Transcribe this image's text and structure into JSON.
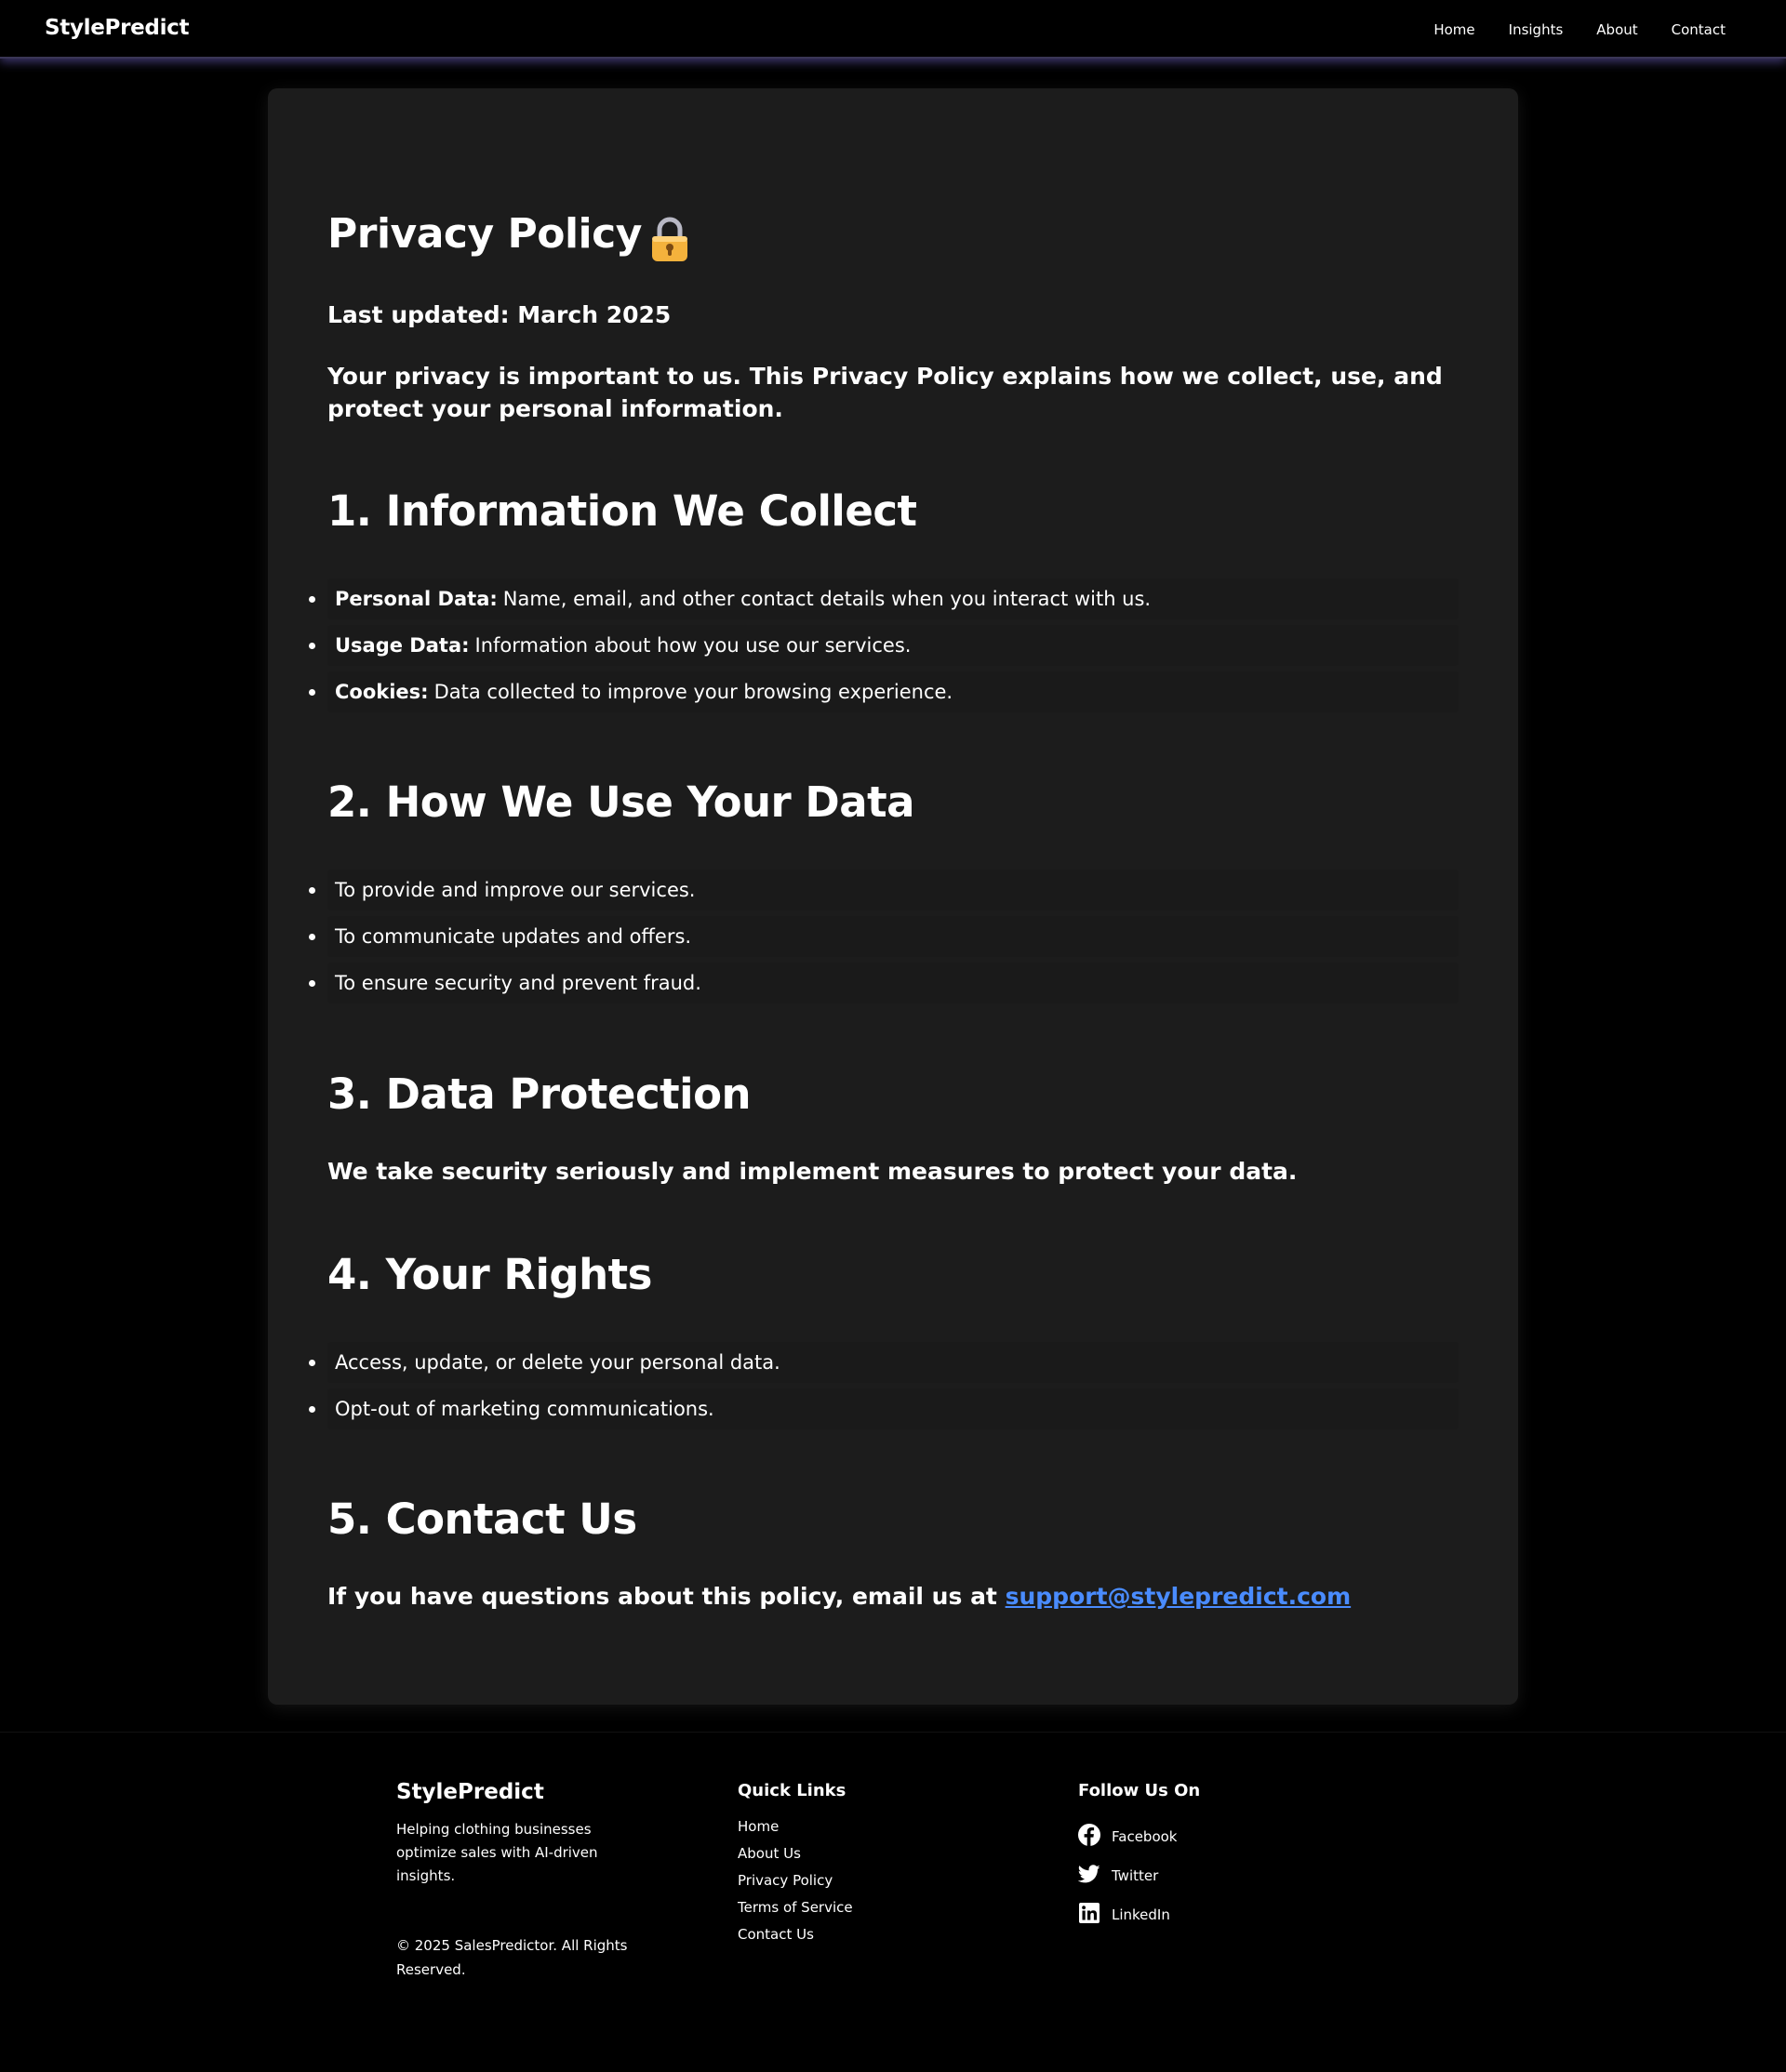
{
  "nav": {
    "brand": "StylePredict",
    "links": [
      "Home",
      "Insights",
      "About",
      "Contact"
    ]
  },
  "policy": {
    "title": "Privacy Policy",
    "title_icon": "lock-icon",
    "updated": "Last updated: March 2025",
    "intro": "Your privacy is important to us. This Privacy Policy explains how we collect, use, and protect your personal information.",
    "sections": [
      {
        "heading": "1. Information We Collect",
        "items": [
          {
            "strong": "Personal Data:",
            "text": "Name, email, and other contact details when you interact with us."
          },
          {
            "strong": "Usage Data:",
            "text": "Information about how you use our services."
          },
          {
            "strong": "Cookies:",
            "text": "Data collected to improve your browsing experience."
          }
        ]
      },
      {
        "heading": "2. How We Use Your Data",
        "items": [
          {
            "text": "To provide and improve our services."
          },
          {
            "text": "To communicate updates and offers."
          },
          {
            "text": "To ensure security and prevent fraud."
          }
        ]
      },
      {
        "heading": "3. Data Protection",
        "paragraph": "We take security seriously and implement measures to protect your data."
      },
      {
        "heading": "4. Your Rights",
        "items": [
          {
            "text": "Access, update, or delete your personal data."
          },
          {
            "text": "Opt-out of marketing communications."
          }
        ]
      },
      {
        "heading": "5. Contact Us",
        "paragraph": "If you have questions about this policy, email us at",
        "email": "support@stylepredict.com"
      }
    ]
  },
  "footer": {
    "brand": "StylePredict",
    "description": "Helping clothing businesses optimize sales with AI-driven insights.",
    "copyright": "© 2025 SalesPredictor. All Rights Reserved.",
    "quick_links_heading": "Quick Links",
    "quick_links": [
      "Home",
      "About Us",
      "Privacy Policy",
      "Terms of Service",
      "Contact Us"
    ],
    "follow_heading": "Follow Us On",
    "social": [
      {
        "label": "Facebook",
        "icon": "facebook-icon"
      },
      {
        "label": "Twitter",
        "icon": "twitter-icon"
      },
      {
        "label": "LinkedIn",
        "icon": "linkedin-icon"
      }
    ]
  },
  "colors": {
    "background": "#000000",
    "card": "#1c1c1c",
    "link": "#4a8cff",
    "nav_glow": "#5a50a0"
  }
}
